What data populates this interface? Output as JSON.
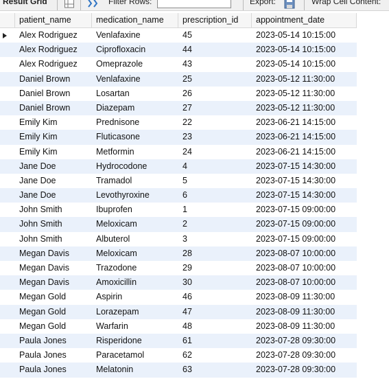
{
  "toolbar": {
    "result_grid_label": "Result Grid",
    "filter_label": "Filter Rows:",
    "filter_value": "",
    "export_label": "Export:",
    "wrap_label": "Wrap Cell Content:"
  },
  "columns": [
    "patient_name",
    "medication_name",
    "prescription_id",
    "appointment_date"
  ],
  "rows": [
    [
      "Alex Rodriguez",
      "Venlafaxine",
      "45",
      "2023-05-14 10:15:00"
    ],
    [
      "Alex Rodriguez",
      "Ciprofloxacin",
      "44",
      "2023-05-14 10:15:00"
    ],
    [
      "Alex Rodriguez",
      "Omeprazole",
      "43",
      "2023-05-14 10:15:00"
    ],
    [
      "Daniel Brown",
      "Venlafaxine",
      "25",
      "2023-05-12 11:30:00"
    ],
    [
      "Daniel Brown",
      "Losartan",
      "26",
      "2023-05-12 11:30:00"
    ],
    [
      "Daniel Brown",
      "Diazepam",
      "27",
      "2023-05-12 11:30:00"
    ],
    [
      "Emily Kim",
      "Prednisone",
      "22",
      "2023-06-21 14:15:00"
    ],
    [
      "Emily Kim",
      "Fluticasone",
      "23",
      "2023-06-21 14:15:00"
    ],
    [
      "Emily Kim",
      "Metformin",
      "24",
      "2023-06-21 14:15:00"
    ],
    [
      "Jane Doe",
      "Hydrocodone",
      "4",
      "2023-07-15 14:30:00"
    ],
    [
      "Jane Doe",
      "Tramadol",
      "5",
      "2023-07-15 14:30:00"
    ],
    [
      "Jane Doe",
      "Levothyroxine",
      "6",
      "2023-07-15 14:30:00"
    ],
    [
      "John Smith",
      "Ibuprofen",
      "1",
      "2023-07-15 09:00:00"
    ],
    [
      "John Smith",
      "Meloxicam",
      "2",
      "2023-07-15 09:00:00"
    ],
    [
      "John Smith",
      "Albuterol",
      "3",
      "2023-07-15 09:00:00"
    ],
    [
      "Megan Davis",
      "Meloxicam",
      "28",
      "2023-08-07 10:00:00"
    ],
    [
      "Megan Davis",
      "Trazodone",
      "29",
      "2023-08-07 10:00:00"
    ],
    [
      "Megan Davis",
      "Amoxicillin",
      "30",
      "2023-08-07 10:00:00"
    ],
    [
      "Megan Gold",
      "Aspirin",
      "46",
      "2023-08-09 11:30:00"
    ],
    [
      "Megan Gold",
      "Lorazepam",
      "47",
      "2023-08-09 11:30:00"
    ],
    [
      "Megan Gold",
      "Warfarin",
      "48",
      "2023-08-09 11:30:00"
    ],
    [
      "Paula Jones",
      "Risperidone",
      "61",
      "2023-07-28 09:30:00"
    ],
    [
      "Paula Jones",
      "Paracetamol",
      "62",
      "2023-07-28 09:30:00"
    ],
    [
      "Paula Jones",
      "Melatonin",
      "63",
      "2023-07-28 09:30:00"
    ]
  ],
  "selected_row": 0
}
